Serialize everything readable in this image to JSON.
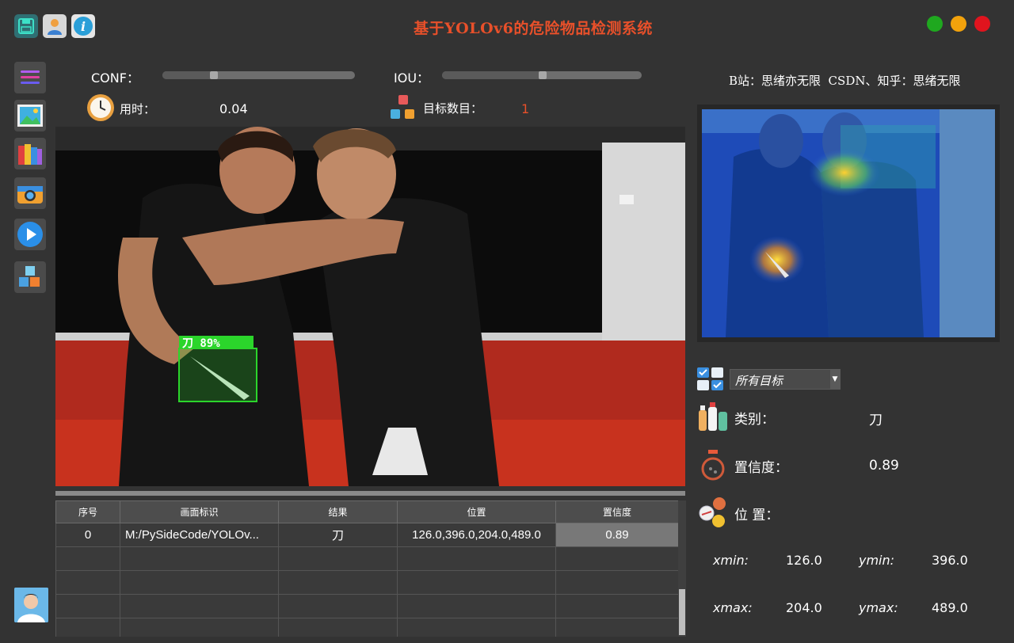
{
  "app": {
    "title": "基于YOLOv6的危险物品检测系统",
    "window_controls": [
      "green",
      "yellow",
      "red"
    ],
    "colors": {
      "accent": "#e8502a",
      "bg": "#333333",
      "detect_box": "#2bd52b",
      "win_green": "#1fa81f",
      "win_yellow": "#f2a20c",
      "win_red": "#e0141e"
    }
  },
  "toolbar": {
    "icons": [
      "save-icon",
      "user-icon",
      "info-icon"
    ]
  },
  "sidebar": {
    "items": [
      "menu-icon",
      "image-icon",
      "folder-icon",
      "camera-icon",
      "video-play-icon",
      "model-cubes-icon"
    ],
    "avatar": "avatar"
  },
  "controls": {
    "conf_label": "CONF：",
    "conf_value": 0.25,
    "iou_label": "IOU：",
    "iou_value": 0.5,
    "time_label": "用时：",
    "time_value": "0.04",
    "count_label": "目标数目：",
    "count_value": "1"
  },
  "detection": {
    "box_label": "刀 89%"
  },
  "credits": "B站：思绪亦无限  CSDN、知乎：思绪无限",
  "table": {
    "headers": [
      "序号",
      "画面标识",
      "结果",
      "位置",
      "置信度"
    ],
    "rows": [
      [
        "0",
        "M:/PySideCode/YOLOv...",
        "刀",
        "126.0,396.0,204.0,489.0",
        "0.89"
      ]
    ],
    "empty_rows": 4
  },
  "result_panel": {
    "target_select": "所有目标",
    "class_label": "类别：",
    "class_value": "刀",
    "conf_label": "置信度：",
    "conf_value": "0.89",
    "pos_label": "位 置：",
    "xmin_label": "xmin:",
    "xmin_value": "126.0",
    "ymin_label": "ymin:",
    "ymin_value": "396.0",
    "xmax_label": "xmax:",
    "xmax_value": "204.0",
    "ymax_label": "ymax:",
    "ymax_value": "489.0"
  }
}
